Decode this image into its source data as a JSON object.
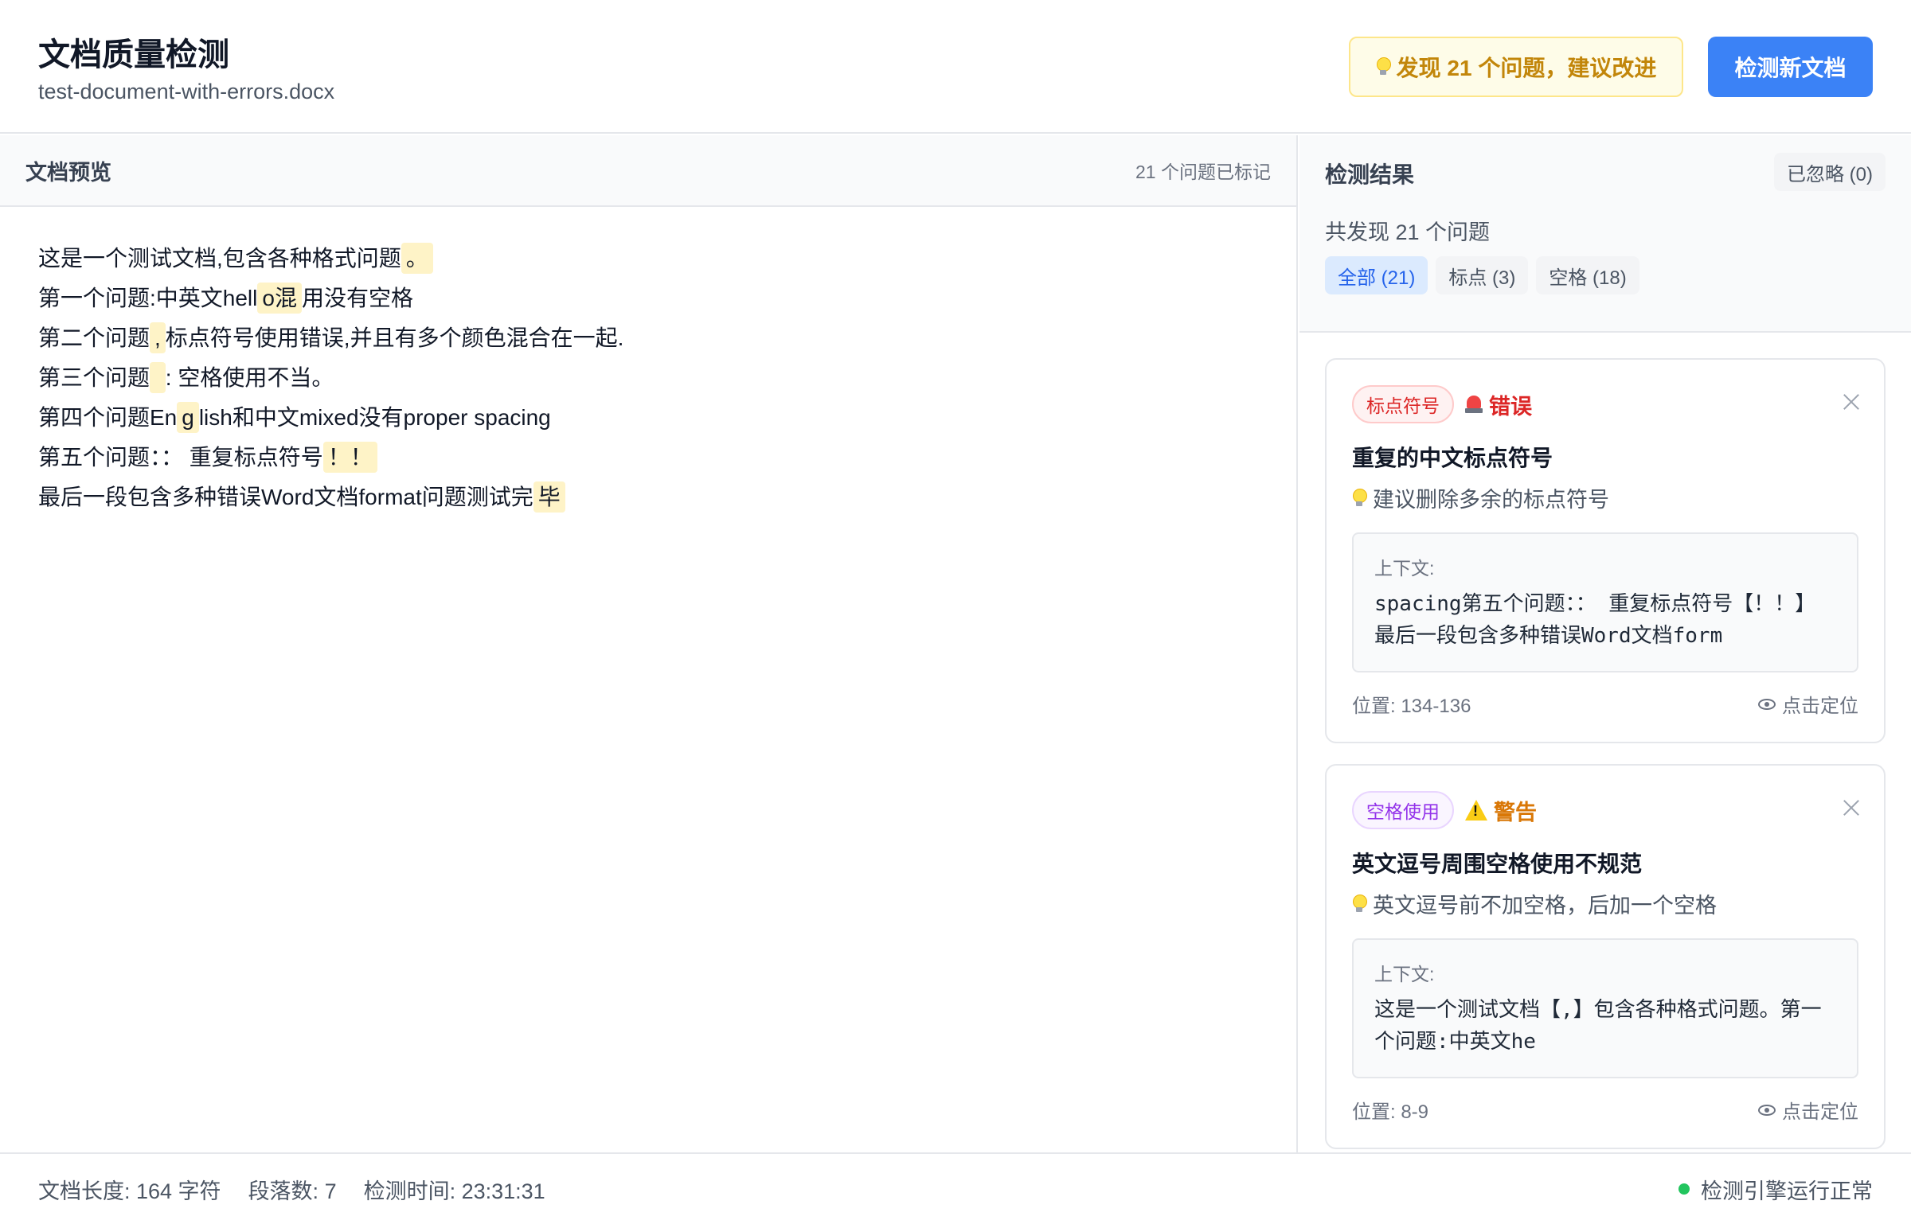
{
  "header": {
    "title": "文档质量检测",
    "file_name": "test-document-with-errors.docx",
    "issue_banner": "发现 21 个问题，建议改进",
    "new_doc_button": "检测新文档"
  },
  "preview": {
    "title": "文档预览",
    "marked_count": "21 个问题已标记",
    "lines": [
      {
        "before": "这是一个测试文档,包含各种格式问题",
        "mark": "。",
        "after": ""
      },
      {
        "before": "第一个问题:中英文hell",
        "mark": "o混",
        "after": "用没有空格"
      },
      {
        "before": "第二个问题",
        "mark": ",",
        "after": "标点符号使用错误,并且有多个颜色混合在一起."
      },
      {
        "before": "第三个问题",
        "mark": " ",
        "after": ": 空格使用不当。"
      },
      {
        "before": "第四个问题En",
        "mark": "g",
        "after": "lish和中文mixed没有proper spacing"
      },
      {
        "before": "第五个问题：： 重复标点符号",
        "mark": "！！",
        "after": ""
      },
      {
        "before": "最后一段包含多种错误Word文档format问题测试完",
        "mark": "毕",
        "after": ""
      }
    ]
  },
  "results": {
    "title": "检测结果",
    "ignored_button": "已忽略 (0)",
    "summary": "共发现 21 个问题",
    "filters": [
      {
        "label": "全部 (21)",
        "active": true
      },
      {
        "label": "标点 (3)",
        "active": false
      },
      {
        "label": "空格 (18)",
        "active": false
      }
    ],
    "cards": [
      {
        "category": "标点符号",
        "severity": "错误",
        "title": "重复的中文标点符号",
        "suggestion": "建议删除多余的标点符号",
        "context_label": "上下文:",
        "context": "spacing第五个问题：： 重复标点符号【！！】最后一段包含多种错误Word文档form",
        "position": "位置: 134-136",
        "locate": "点击定位"
      },
      {
        "category": "空格使用",
        "severity": "警告",
        "title": "英文逗号周围空格使用不规范",
        "suggestion": "英文逗号前不加空格，后加一个空格",
        "context_label": "上下文:",
        "context": "这是一个测试文档【,】包含各种格式问题。第一个问题:中英文he",
        "position": "位置: 8-9",
        "locate": "点击定位"
      }
    ]
  },
  "footer": {
    "length": "文档长度: 164 字符",
    "paragraphs": "段落数: 7",
    "time": "检测时间: 23:31:31",
    "engine_status": "检测引擎运行正常"
  },
  "colors": {
    "primary": "#3b82f6",
    "highlight": "#fef3c7",
    "error": "#dc2626",
    "warning": "#d97706",
    "status_ok": "#22c55e"
  }
}
